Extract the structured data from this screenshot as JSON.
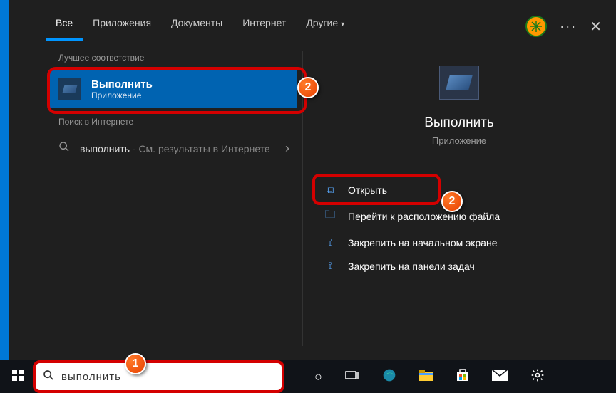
{
  "tabs": {
    "all": "Все",
    "apps": "Приложения",
    "docs": "Документы",
    "internet": "Интернет",
    "other": "Другие"
  },
  "left": {
    "best_label": "Лучшее соответствие",
    "best_title": "Выполнить",
    "best_sub": "Приложение",
    "web_label": "Поиск в Интернете",
    "web_query": "выполнить",
    "web_suffix": " - См. результаты в Интернете"
  },
  "right": {
    "title": "Выполнить",
    "sub": "Приложение",
    "actions": {
      "open": "Открыть",
      "location": "Перейти к расположению файла",
      "pin_start": "Закрепить на начальном экране",
      "pin_taskbar": "Закрепить на панели задач"
    }
  },
  "search": {
    "value": "выполнить"
  },
  "badges": {
    "b1": "1",
    "b2": "2",
    "b3": "2"
  }
}
